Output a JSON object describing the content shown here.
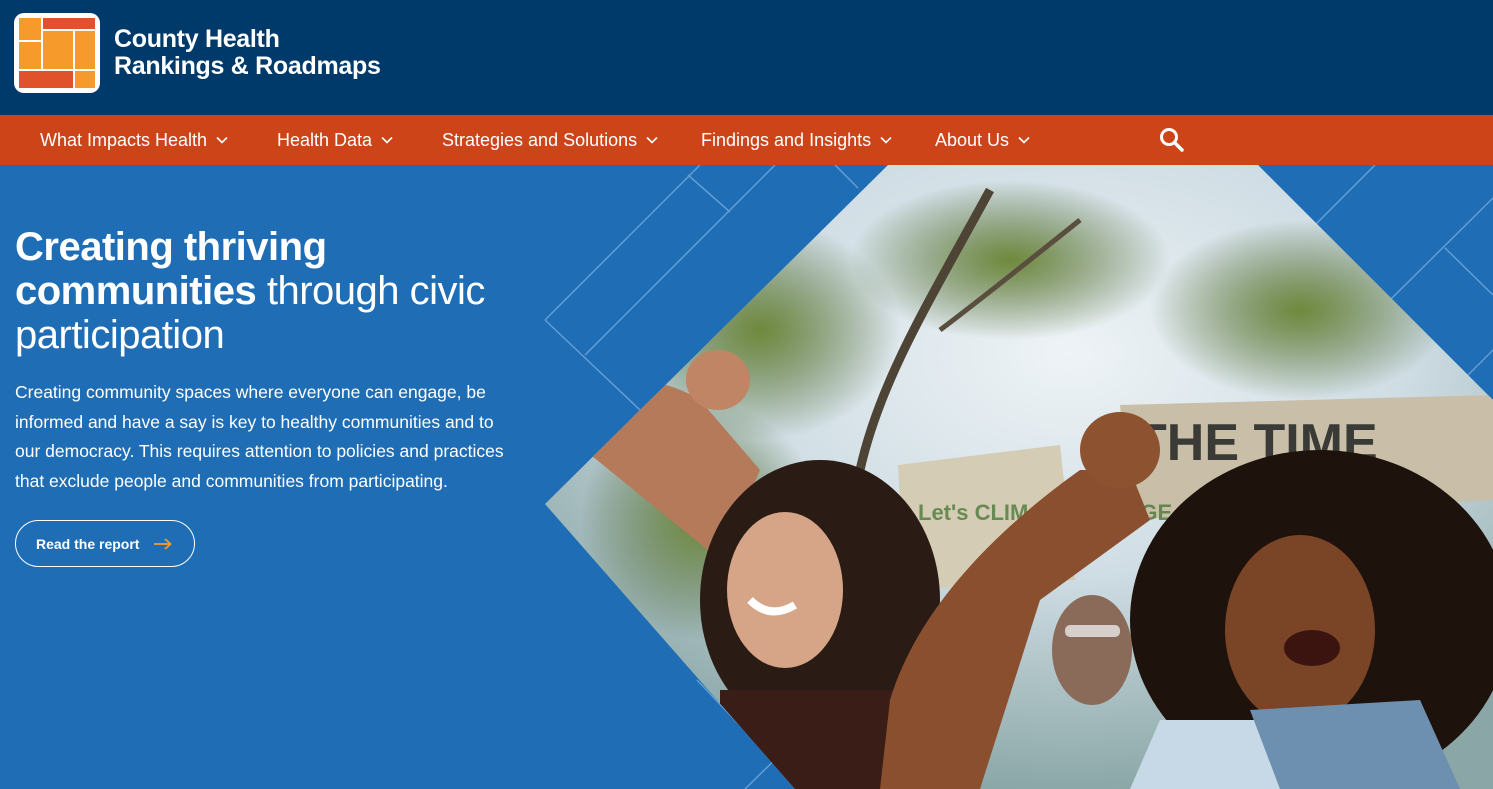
{
  "brand": {
    "line1": "County Health",
    "line2": "Rankings & Roadmaps"
  },
  "nav": {
    "items": [
      {
        "label": "What Impacts Health"
      },
      {
        "label": "Health Data"
      },
      {
        "label": "Strategies and Solutions"
      },
      {
        "label": "Findings and Insights"
      },
      {
        "label": "About Us"
      }
    ],
    "search_icon": "search-icon"
  },
  "hero": {
    "headline_bold": "Creating thriving communities",
    "headline_rest": "through civic participation",
    "body": "Creating community spaces where everyone can engage, be informed and have a say is key to healthy communities and to our democracy. This requires attention to policies and practices that exclude people and communities from participating.",
    "cta_label": "Read the report",
    "sign_text": "THE TIME",
    "sign_small": "Let's CLIMATE CHANGE"
  },
  "colors": {
    "header_bg": "#003a6b",
    "nav_bg": "#cd4419",
    "hero_bg": "#1e6db5",
    "accent_orange": "#f59a2b"
  }
}
